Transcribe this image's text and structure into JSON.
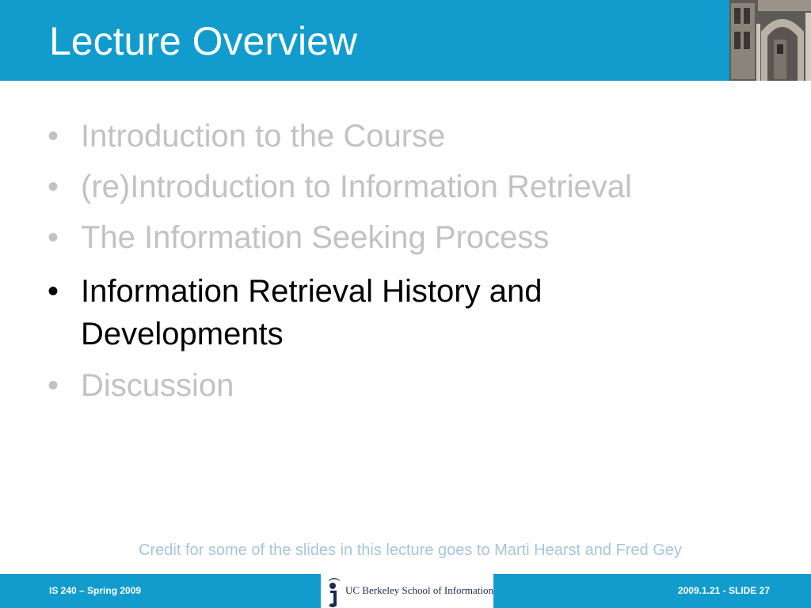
{
  "slide": {
    "title": "Lecture Overview",
    "bullets": [
      {
        "text": "Introduction to the Course",
        "state": "dimmed"
      },
      {
        "text": "(re)Introduction to Information Retrieval",
        "state": "dimmed"
      },
      {
        "text": "The Information Seeking Process",
        "state": "dimmed"
      },
      {
        "text": "Information Retrieval History and",
        "continuation": "Developments",
        "state": "active"
      },
      {
        "text": "Discussion",
        "state": "dimmed"
      }
    ],
    "bullet_marker": "•",
    "credit": "Credit for some of the slides in this lecture goes to Marti Hearst and Fred Gey"
  },
  "footer": {
    "course": "IS 240 – Spring 2009",
    "logo_text": "UC Berkeley School of Information",
    "slide_ref": "2009.1.21 - SLIDE 27"
  },
  "colors": {
    "accent": "#119ccd",
    "dimmed_text": "#c2c2c2",
    "active_text": "#000000",
    "credit_text": "#a6c6d8"
  },
  "icons": {
    "header_image": "building-archway-photo",
    "logo_mark": "ischool-i-logo-icon"
  }
}
